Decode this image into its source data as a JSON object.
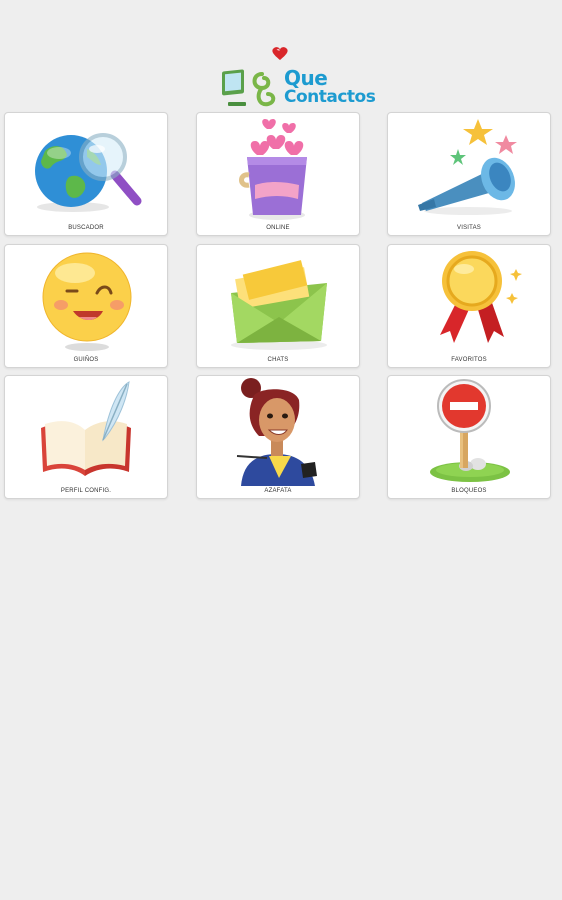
{
  "logo": {
    "line1": "Que",
    "line2": "Contactos"
  },
  "colors": {
    "background": "#eeeeee",
    "tile_background": "#ffffff",
    "brand_blue": "#1d9bd0",
    "brand_green": "#7ab648"
  },
  "tiles": [
    {
      "label": "BUSCADOR",
      "icon": "globe-magnifier-icon"
    },
    {
      "label": "ONLINE",
      "icon": "bucket-of-hearts-icon"
    },
    {
      "label": "VISITAS",
      "icon": "telescope-stars-icon"
    },
    {
      "label": "GUIÑOS",
      "icon": "winking-smiley-icon"
    },
    {
      "label": "CHATS",
      "icon": "envelope-letters-icon"
    },
    {
      "label": "FAVORITOS",
      "icon": "award-medal-icon"
    },
    {
      "label": "PERFIL CONFIG.",
      "icon": "book-quill-icon"
    },
    {
      "label": "AZAFATA",
      "icon": "hostess-woman-icon"
    },
    {
      "label": "BLOQUEOS",
      "icon": "no-entry-sign-icon"
    }
  ]
}
